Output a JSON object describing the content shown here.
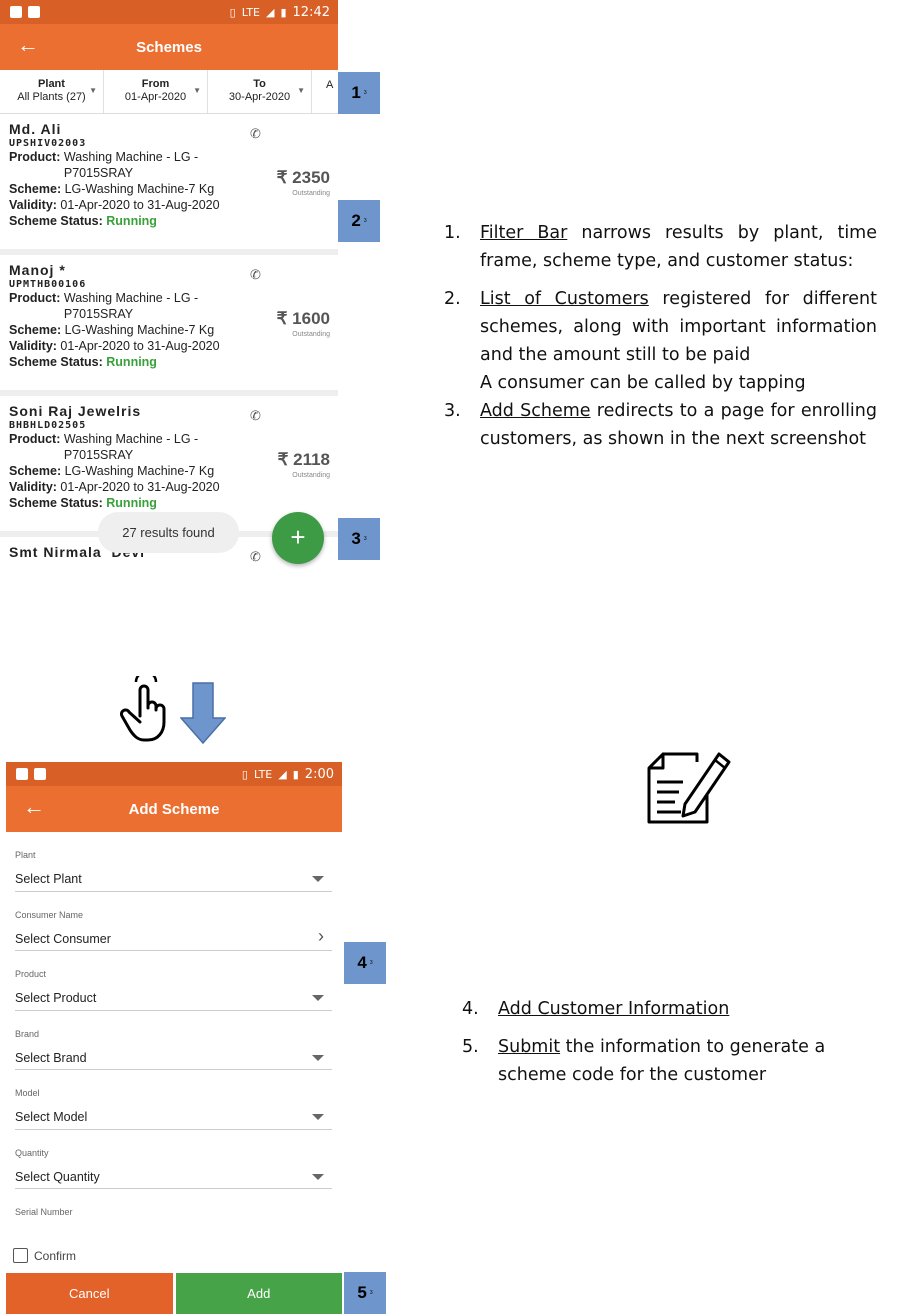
{
  "screen1": {
    "statusbar": {
      "time": "12:42",
      "signal": "LTE"
    },
    "appbar": {
      "title": "Schemes",
      "back_icon": "arrow-left-icon"
    },
    "filters": [
      {
        "label": "Plant",
        "value": "All Plants (27)"
      },
      {
        "label": "From",
        "value": "01-Apr-2020"
      },
      {
        "label": "To",
        "value": "30-Apr-2020"
      },
      {
        "label": "",
        "value": "A"
      }
    ],
    "customers": [
      {
        "name": "Md. Ali",
        "code": "UPSHIV02003",
        "product_label": "Product:",
        "product": "Washing Machine - LG - P7015SRAY",
        "scheme_label": "Scheme:",
        "scheme": "LG-Washing Machine-7 Kg",
        "validity_label": "Validity:",
        "validity": "01-Apr-2020 to 31-Aug-2020",
        "status_label": "Scheme Status:",
        "status": "Running",
        "amount": "₹ 2350",
        "amount_sub": "Outstanding"
      },
      {
        "name": "Manoj *",
        "code": "UPMTHB00106",
        "product_label": "Product:",
        "product": "Washing Machine - LG - P7015SRAY",
        "scheme_label": "Scheme:",
        "scheme": "LG-Washing Machine-7 Kg",
        "validity_label": "Validity:",
        "validity": "01-Apr-2020 to 31-Aug-2020",
        "status_label": "Scheme Status:",
        "status": "Running",
        "amount": "₹ 1600",
        "amount_sub": "Outstanding"
      },
      {
        "name": "Soni Raj Jewelris",
        "code": "BHBHLD02505",
        "product_label": "Product:",
        "product": "Washing Machine - LG - P7015SRAY",
        "scheme_label": "Scheme:",
        "scheme": "LG-Washing Machine-7 Kg",
        "validity_label": "Validity:",
        "validity": "01-Apr-2020 to 31-Aug-2020",
        "status_label": "Scheme Status:",
        "status": "Running",
        "amount": "₹ 2118",
        "amount_sub": "Outstanding"
      },
      {
        "name": "Smt Nirmala  Devi"
      }
    ],
    "toast": "27 results found",
    "fab": "+"
  },
  "screen2": {
    "statusbar": {
      "time": "2:00",
      "signal": "LTE"
    },
    "appbar": {
      "title": "Add Scheme",
      "back_icon": "arrow-left-icon"
    },
    "fields": [
      {
        "label": "Plant",
        "value": "Select Plant",
        "control": "dropdown"
      },
      {
        "label": "Consumer Name",
        "value": "Select Consumer",
        "control": "chevron"
      },
      {
        "label": "Product",
        "value": "Select Product",
        "control": "dropdown"
      },
      {
        "label": "Brand",
        "value": "Select Brand",
        "control": "dropdown"
      },
      {
        "label": "Model",
        "value": "Select Model",
        "control": "dropdown"
      },
      {
        "label": "Quantity",
        "value": "Select Quantity",
        "control": "dropdown"
      },
      {
        "label": "Serial Number",
        "value": "",
        "control": "text"
      }
    ],
    "confirm_label": "Confirm",
    "cancel_label": "Cancel",
    "add_label": "Add"
  },
  "callouts": [
    {
      "number": "1",
      "mark": "3"
    },
    {
      "number": "2",
      "mark": "3"
    },
    {
      "number": "3",
      "mark": "3"
    },
    {
      "number": "4",
      "mark": "3"
    },
    {
      "number": "5",
      "mark": "3"
    }
  ],
  "notes_top": [
    {
      "num": "1.",
      "link": "Filter Bar",
      "text": " narrows results by plant, time frame, scheme type, and customer status:"
    },
    {
      "num": "2.",
      "link": "List of Customers",
      "text": " registered for different schemes, along with important information and the amount still to be paid",
      "extra": "A consumer can be called by tapping"
    },
    {
      "num": "3.",
      "link": "Add Scheme",
      "text": " redirects to a page for enrolling customers, as shown in the next screenshot"
    }
  ],
  "notes_bottom": [
    {
      "num": "4.",
      "link": "Add Customer Information",
      "text": ""
    },
    {
      "num": "5.",
      "link": "Submit",
      "text": " the information to generate a scheme code for the customer"
    }
  ],
  "icons": {
    "hand": "tap-hand-icon",
    "arrow": "down-arrow-icon",
    "document": "document-pen-icon"
  },
  "colors": {
    "statusbar": "#d85f25",
    "appbar": "#ec6f32",
    "running": "#3aa13a",
    "fab": "#3d9a45",
    "callout": "#6f96cc",
    "cancel": "#e2622a",
    "add": "#47a347"
  }
}
